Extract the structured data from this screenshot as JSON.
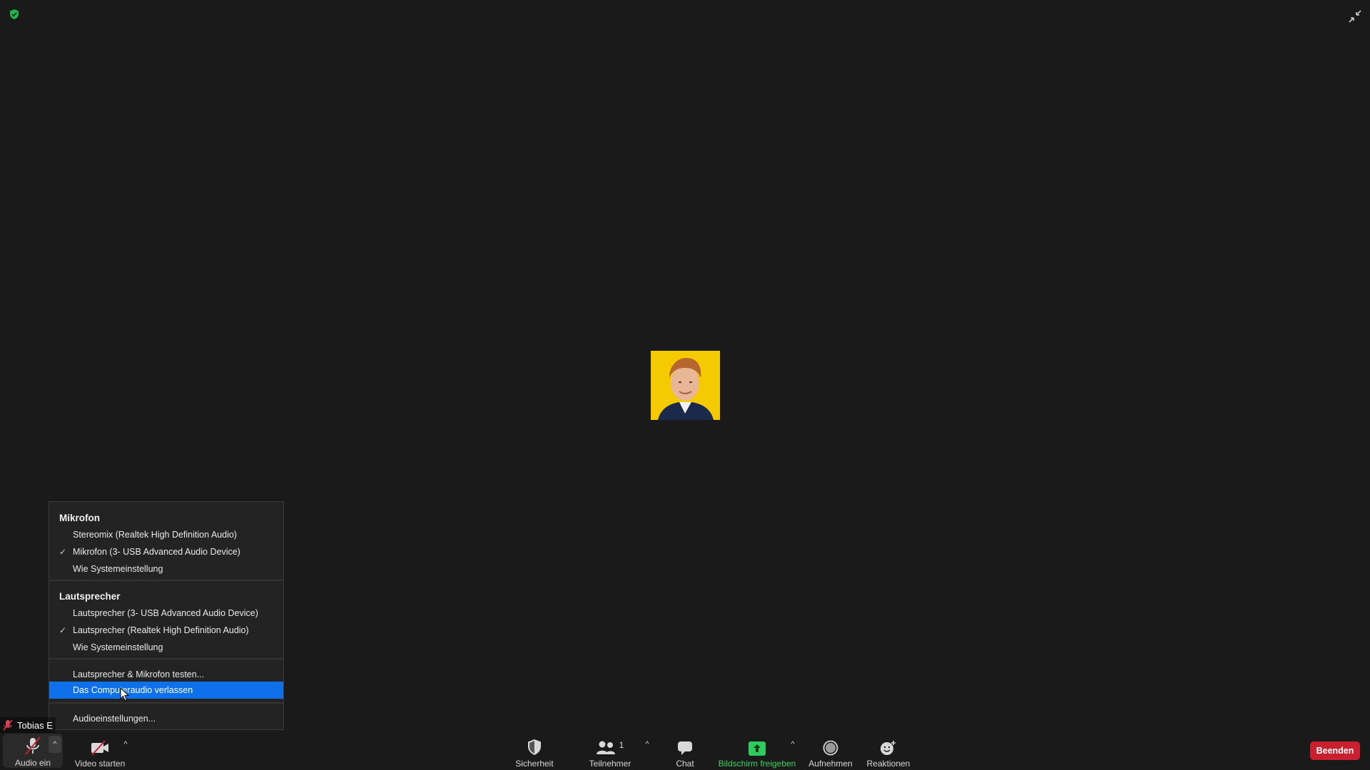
{
  "top": {
    "security_icon": "shield-check-icon",
    "exit_fullscreen_icon": "exit-fullscreen-icon"
  },
  "participant": {
    "name_tag": "Tobias E",
    "avatar_bg": "#f5cb00",
    "mic_muted": true
  },
  "audio_menu": {
    "microphone_header": "Mikrofon",
    "microphones": [
      {
        "label": "Stereomix (Realtek High Definition Audio)",
        "checked": false
      },
      {
        "label": "Mikrofon (3- USB Advanced Audio Device)",
        "checked": true
      },
      {
        "label": "Wie Systemeinstellung",
        "checked": false
      }
    ],
    "speaker_header": "Lautsprecher",
    "speakers": [
      {
        "label": "Lautsprecher (3- USB Advanced Audio Device)",
        "checked": false
      },
      {
        "label": "Lautsprecher (Realtek High Definition Audio)",
        "checked": true
      },
      {
        "label": "Wie Systemeinstellung",
        "checked": false
      }
    ],
    "test_label": "Lautsprecher & Mikrofon testen...",
    "leave_audio_label": "Das Computeraudio verlassen",
    "settings_label": "Audioeinstellungen...",
    "check_glyph": "✓",
    "highlight_color": "#0e71eb"
  },
  "toolbar": {
    "audio_label": "Audio ein",
    "video_label": "Video starten",
    "security_label": "Sicherheit",
    "participants_label": "Teilnehmer",
    "participants_count": "1",
    "chat_label": "Chat",
    "share_label": "Bildschirm freigeben",
    "record_label": "Aufnehmen",
    "reactions_label": "Reaktionen",
    "end_label": "Beenden",
    "caret": "^",
    "share_color": "#3fd266",
    "end_color": "#c8202e"
  }
}
